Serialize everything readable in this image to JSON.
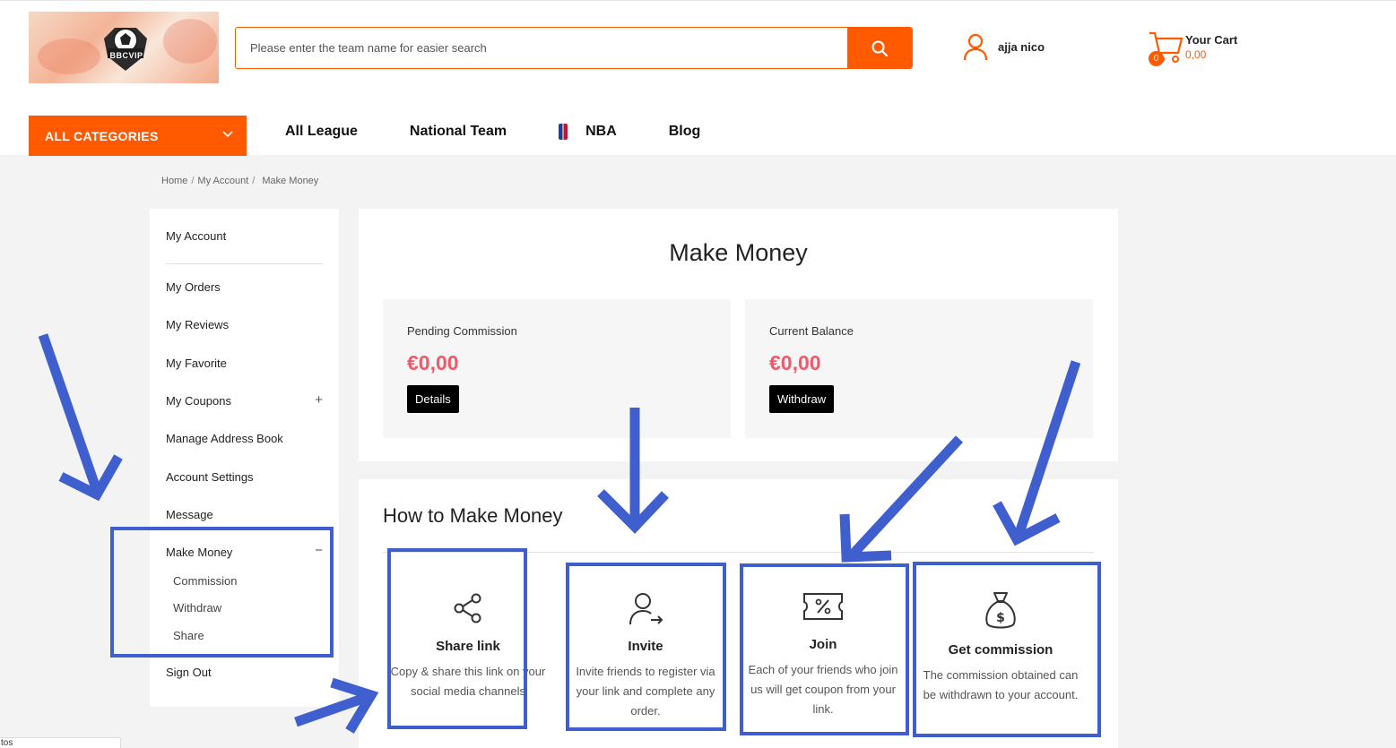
{
  "header": {
    "logo_text": "BBCVIP",
    "search_placeholder": "Please enter the team name for easier search",
    "user_name": "ajja nico",
    "cart": {
      "label": "Your Cart",
      "amount": "0,00",
      "count": "0"
    }
  },
  "nav": {
    "categories_label": "ALL CATEGORIES",
    "items": [
      "All League",
      "National Team",
      "NBA",
      "Blog"
    ]
  },
  "breadcrumb": [
    "Home",
    "My Account",
    "Make Money"
  ],
  "sidebar": {
    "account": "My Account",
    "items": [
      "My Orders",
      "My Reviews",
      "My Favorite",
      "My Coupons",
      "Manage Address Book",
      "Account Settings",
      "Message",
      "Make Money"
    ],
    "sub_items": [
      "Commission",
      "Withdraw",
      "Share"
    ],
    "sign_out": "Sign Out"
  },
  "main": {
    "title": "Make Money",
    "pending": {
      "label": "Pending Commission",
      "value": "€0,00",
      "button": "Details"
    },
    "balance": {
      "label": "Current Balance",
      "value": "€0,00",
      "button": "Withdraw"
    }
  },
  "how": {
    "title": "How to Make Money",
    "steps": [
      {
        "title": "Share link",
        "desc1": "Copy & share this link on your",
        "desc2": "social media channels"
      },
      {
        "title": "Invite",
        "desc1": "Invite friends to register via",
        "desc2": "your link and complete any",
        "desc3": "order."
      },
      {
        "title": "Join",
        "desc1": "Each of your friends who join",
        "desc2": "us will get coupon from your",
        "desc3": "link."
      },
      {
        "title": "Get commission",
        "desc1": "The commission obtained can",
        "desc2": "be withdrawn to your account."
      }
    ]
  },
  "cookie_text": "tos",
  "colors": {
    "accent": "#ff5a00",
    "price": "#f0596a",
    "annotation": "#3f5fcf"
  }
}
